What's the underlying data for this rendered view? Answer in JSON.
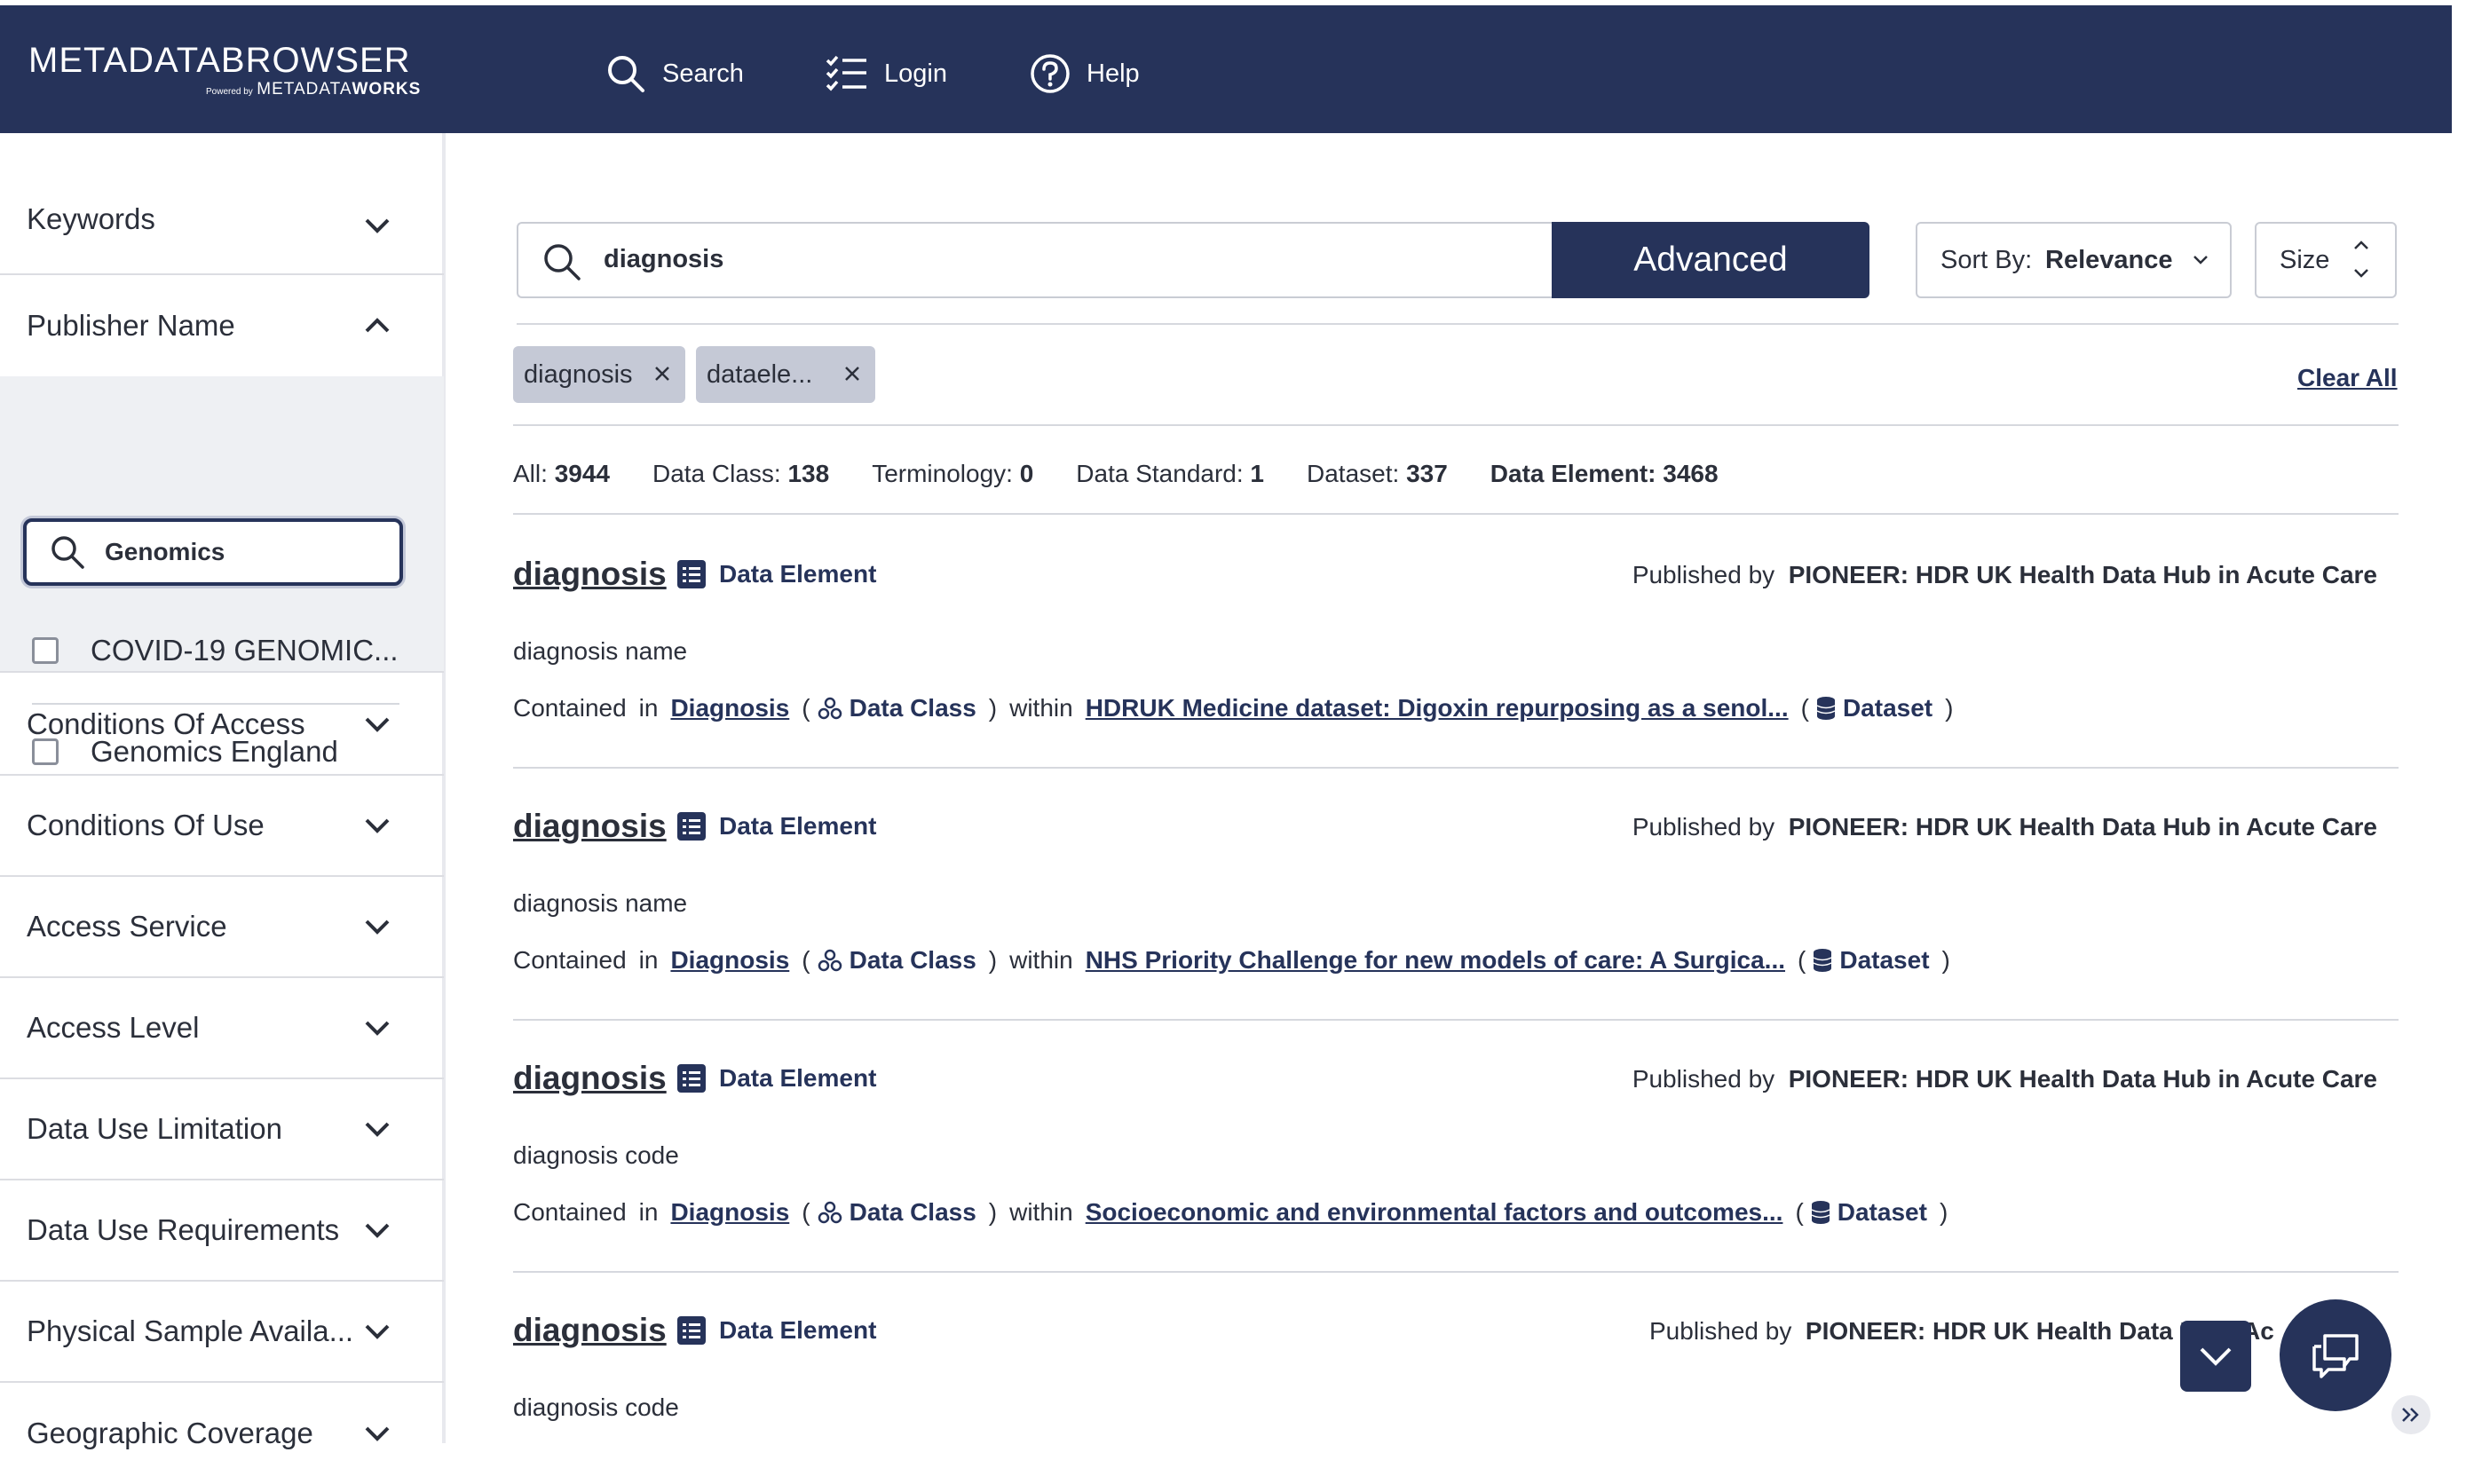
{
  "header": {
    "logo_main": "METADATABROWSER",
    "logo_powered": "Powered by",
    "logo_works_a": "METADATA",
    "logo_works_b": "WORKS",
    "nav": [
      {
        "label": "Search",
        "icon": "search-icon"
      },
      {
        "label": "Login",
        "icon": "checklist-icon"
      },
      {
        "label": "Help",
        "icon": "help-circle-icon"
      }
    ]
  },
  "sidebar": {
    "sections": [
      {
        "label": "Keywords",
        "expanded": false
      },
      {
        "label": "Publisher Name",
        "expanded": true
      },
      {
        "label": "Conditions Of Access",
        "expanded": false
      },
      {
        "label": "Conditions Of Use",
        "expanded": false
      },
      {
        "label": "Access Service",
        "expanded": false
      },
      {
        "label": "Access Level",
        "expanded": false
      },
      {
        "label": "Data Use Limitation",
        "expanded": false
      },
      {
        "label": "Data Use Requirements",
        "expanded": false
      },
      {
        "label": "Physical Sample Availa...",
        "expanded": false
      },
      {
        "label": "Geographic Coverage",
        "expanded": false
      }
    ],
    "publisher_filter": {
      "search_value": "Genomics",
      "options": [
        {
          "label": "COVID-19 GENOMIC...",
          "checked": false
        },
        {
          "label": "Genomics England",
          "checked": false
        }
      ]
    }
  },
  "main": {
    "search_value": "diagnosis",
    "advanced_label": "Advanced",
    "sort_label": "Sort By:",
    "sort_value": "Relevance",
    "size_label": "Size",
    "chips": [
      "diagnosis",
      "dataele..."
    ],
    "clear_all": "Clear All",
    "counts": [
      {
        "label": "All:",
        "value": "3944"
      },
      {
        "label": "Data Class:",
        "value": "138"
      },
      {
        "label": "Terminology:",
        "value": "0"
      },
      {
        "label": "Data Standard:",
        "value": "1"
      },
      {
        "label": "Dataset:",
        "value": "337"
      },
      {
        "label": "Data Element:",
        "value": "3468"
      }
    ],
    "results": [
      {
        "title": "diagnosis",
        "type": "Data Element",
        "published_by": "Published by",
        "publisher": "PIONEER: HDR UK Health Data Hub in Acute Care",
        "description": "diagnosis name",
        "contained": "Contained",
        "in": "in",
        "class_link": "Diagnosis",
        "class_type": "Data Class",
        "within": "within",
        "dataset_link": "HDRUK Medicine dataset: Digoxin repurposing as a senol...",
        "dataset_type": "Dataset"
      },
      {
        "title": "diagnosis",
        "type": "Data Element",
        "published_by": "Published by",
        "publisher": "PIONEER: HDR UK Health Data Hub in Acute Care",
        "description": "diagnosis name",
        "contained": "Contained",
        "in": "in",
        "class_link": "Diagnosis",
        "class_type": "Data Class",
        "within": "within",
        "dataset_link": "NHS Priority Challenge for new models of care: A Surgica...",
        "dataset_type": "Dataset"
      },
      {
        "title": "diagnosis",
        "type": "Data Element",
        "published_by": "Published by",
        "publisher": "PIONEER: HDR UK Health Data Hub in Acute Care",
        "description": "diagnosis code",
        "contained": "Contained",
        "in": "in",
        "class_link": "Diagnosis",
        "class_type": "Data Class",
        "within": "within",
        "dataset_link": "Socioeconomic and environmental factors and outcomes...",
        "dataset_type": "Dataset"
      },
      {
        "title": "diagnosis",
        "type": "Data Element",
        "published_by": "Published by",
        "publisher": "PIONEER: HDR UK Health Data H",
        "publisher_tail": "Ac",
        "description": "diagnosis code"
      }
    ]
  },
  "colors": {
    "brand": "#26335a",
    "chip": "#c5c9d6",
    "panel": "#eef0f3"
  }
}
